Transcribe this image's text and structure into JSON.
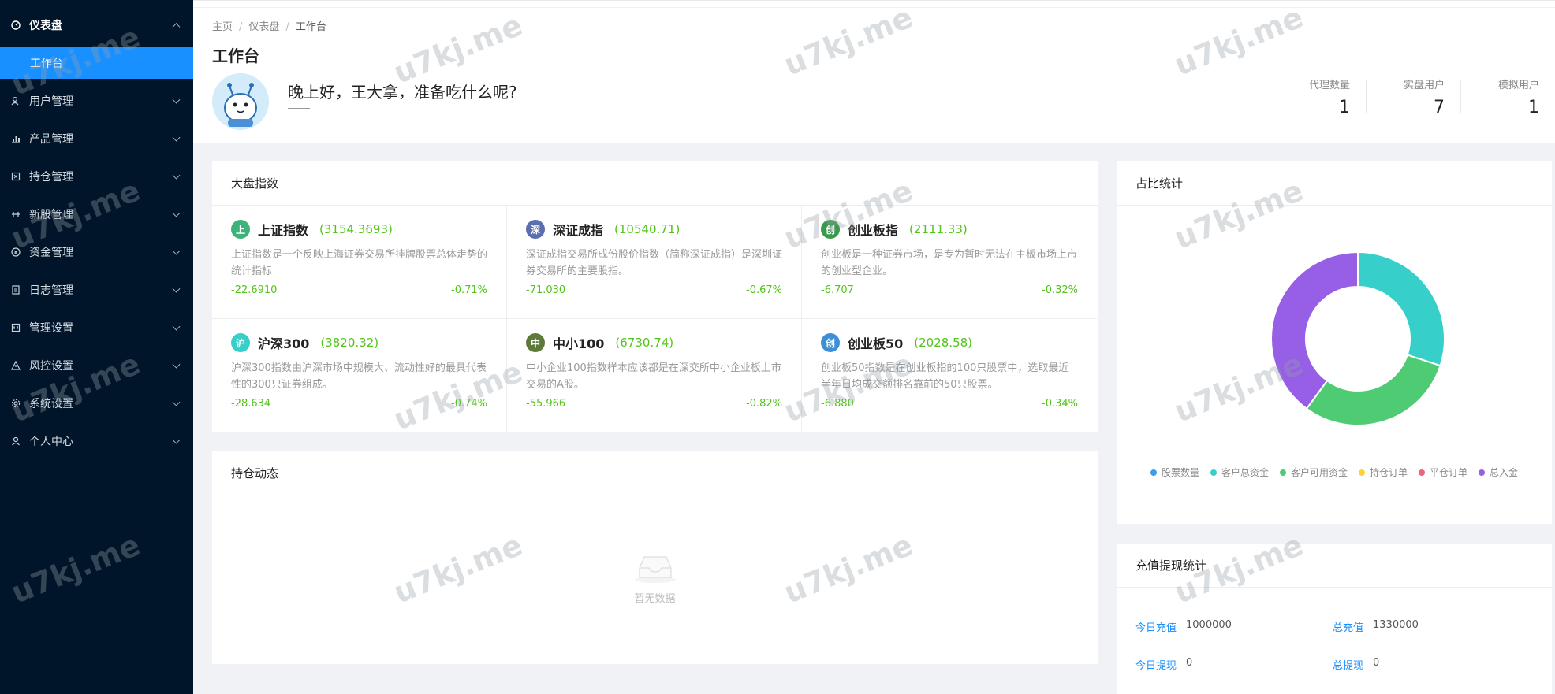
{
  "sidebar": {
    "dashboard": {
      "label": "仪表盘",
      "icon": "dashboard-icon"
    },
    "active_sub": "工作台",
    "items": [
      {
        "label": "用户管理",
        "icon": "users-icon"
      },
      {
        "label": "产品管理",
        "icon": "chart-icon"
      },
      {
        "label": "持仓管理",
        "icon": "position-icon"
      },
      {
        "label": "新股管理",
        "icon": "ipo-icon"
      },
      {
        "label": "资金管理",
        "icon": "money-icon"
      },
      {
        "label": "日志管理",
        "icon": "log-icon"
      },
      {
        "label": "管理设置",
        "icon": "admin-settings-icon"
      },
      {
        "label": "风控设置",
        "icon": "warning-icon"
      },
      {
        "label": "系统设置",
        "icon": "gear-icon"
      },
      {
        "label": "个人中心",
        "icon": "user-icon"
      }
    ]
  },
  "header": {
    "breadcrumb": [
      "主页",
      "仪表盘",
      "工作台"
    ],
    "title": "工作台",
    "greeting": "晚上好，王大拿，准备吃什么呢?",
    "stats": [
      {
        "label": "代理数量",
        "value": "1"
      },
      {
        "label": "实盘用户",
        "value": "7"
      },
      {
        "label": "模拟用户",
        "value": "1"
      }
    ]
  },
  "index_card": {
    "title": "大盘指数",
    "items": [
      {
        "badge": "上",
        "badge_color": "#3bb37a",
        "name": "上证指数",
        "value": "(3154.3693)",
        "desc": "上证指数是一个反映上海证券交易所挂牌股票总体走势的统计指标",
        "change": "-22.6910",
        "pct": "-0.71%"
      },
      {
        "badge": "深",
        "badge_color": "#5b6fb0",
        "name": "深证成指",
        "value": "(10540.71)",
        "desc": "深证成指交易所成份股价指数（简称深证成指）是深圳证券交易所的主要股指。",
        "change": "-71.030",
        "pct": "-0.67%"
      },
      {
        "badge": "创",
        "badge_color": "#3a9a4b",
        "name": "创业板指",
        "value": "(2111.33)",
        "desc": "创业板是一种证券市场，是专为暂时无法在主板市场上市的创业型企业。",
        "change": "-6.707",
        "pct": "-0.32%"
      },
      {
        "badge": "沪",
        "badge_color": "#36cfc9",
        "name": "沪深300",
        "value": "(3820.32)",
        "desc": "沪深300指数由沪深市场中规模大、流动性好的最具代表性的300只证券组成。",
        "change": "-28.634",
        "pct": "-0.74%"
      },
      {
        "badge": "中",
        "badge_color": "#5e7a3a",
        "name": "中小100",
        "value": "(6730.74)",
        "desc": "中小企业100指数样本应该都是在深交所中小企业板上市交易的A股。",
        "change": "-55.966",
        "pct": "-0.82%"
      },
      {
        "badge": "创",
        "badge_color": "#3d8fd6",
        "name": "创业板50",
        "value": "(2028.58)",
        "desc": "创业板50指数是在创业板指的100只股票中，选取最近半年日均成交额排名靠前的50只股票。",
        "change": "-6.880",
        "pct": "-0.34%"
      }
    ]
  },
  "holdings_card": {
    "title": "持仓动态",
    "empty_text": "暂无数据"
  },
  "ratio_card": {
    "title": "占比统计",
    "chart_data": {
      "type": "pie",
      "donut": true,
      "categories": [
        "股票数量",
        "客户总资金",
        "客户可用资金",
        "持仓订单",
        "平仓订单",
        "总入金"
      ],
      "values": [
        0,
        1000000,
        1000000,
        0,
        0,
        1330000
      ],
      "colors": [
        "#3a9df0",
        "#36cfc9",
        "#4ecb73",
        "#fbd437",
        "#f2637b",
        "#975fe5"
      ],
      "legend": "bottom"
    }
  },
  "recharge_card": {
    "title": "充值提现统计",
    "rows": [
      [
        {
          "label": "今日充值",
          "value": "1000000"
        },
        {
          "label": "总充值",
          "value": "1330000"
        }
      ],
      [
        {
          "label": "今日提现",
          "value": "0"
        },
        {
          "label": "总提现",
          "value": "0"
        }
      ]
    ]
  },
  "watermark_text": "u7kj.me"
}
